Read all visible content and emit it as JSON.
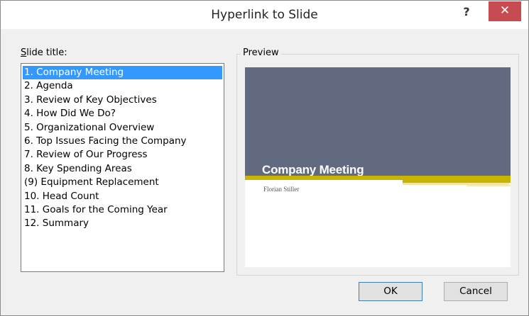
{
  "dialog": {
    "title": "Hyperlink to Slide",
    "help_glyph": "?",
    "close_glyph": "✕"
  },
  "slide_list": {
    "label_accel": "S",
    "label_rest": "lide title:",
    "items": [
      "1. Company Meeting",
      "2. Agenda",
      "3. Review of Key Objectives",
      "4. How Did We Do?",
      "5. Organizational Overview",
      "6. Top Issues Facing the Company",
      "7. Review of Our Progress",
      "8. Key Spending Areas",
      "(9) Equipment Replacement",
      "10. Head Count",
      "11. Goals for the Coming Year",
      "12. Summary"
    ],
    "selected_index": 0
  },
  "preview": {
    "label": "Preview",
    "slide_title": "Company Meeting",
    "slide_subtitle": "Florian Stiller",
    "colors": {
      "header": "#626a82",
      "accent": "#c8b400"
    }
  },
  "buttons": {
    "ok": "OK",
    "cancel": "Cancel"
  }
}
